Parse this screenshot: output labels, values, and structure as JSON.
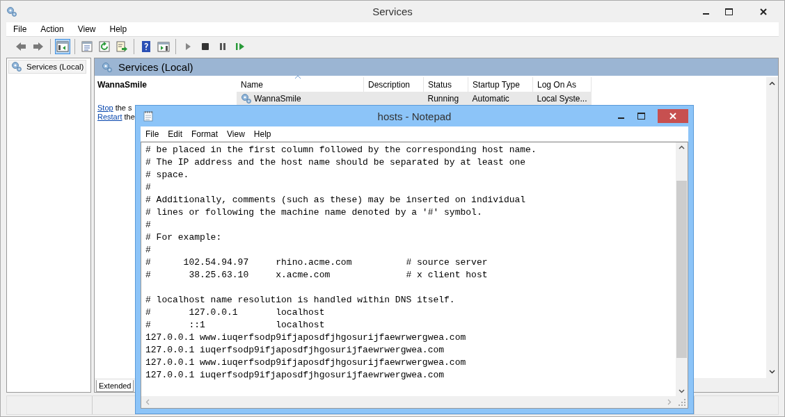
{
  "window": {
    "title": "Services"
  },
  "menu": [
    "File",
    "Action",
    "View",
    "Help"
  ],
  "toolbar": [
    [
      {
        "kind": "back",
        "selected": false
      },
      {
        "kind": "forward",
        "selected": false
      }
    ],
    [
      {
        "kind": "tree",
        "selected": true
      }
    ],
    [
      {
        "kind": "properties",
        "selected": false
      },
      {
        "kind": "refresh",
        "selected": false
      },
      {
        "kind": "export",
        "selected": false
      }
    ],
    [
      {
        "kind": "help",
        "selected": false
      },
      {
        "kind": "pane",
        "selected": false
      }
    ],
    [
      {
        "kind": "play",
        "selected": false
      },
      {
        "kind": "stop",
        "selected": false
      },
      {
        "kind": "pause",
        "selected": false
      },
      {
        "kind": "resume",
        "selected": false
      }
    ]
  ],
  "tree": {
    "items": [
      {
        "label": "Services (Local)",
        "selected": true
      }
    ]
  },
  "panel": {
    "title": "Services (Local)",
    "service_name": "WannaSmile",
    "actions": [
      {
        "link": "Stop",
        "text": " the s"
      },
      {
        "link": "Restart",
        "text": " the"
      }
    ]
  },
  "table": {
    "columns": [
      "Name",
      "Description",
      "Status",
      "Startup Type",
      "Log On As"
    ],
    "rows": [
      {
        "name": "WannaSmile",
        "description": "",
        "status": "Running",
        "startup_type": "Automatic",
        "log_on_as": "Local Syste...",
        "selected": true
      }
    ]
  },
  "tabs": [
    {
      "label": "Extended",
      "selected": true
    }
  ],
  "notepad": {
    "title": "hosts - Notepad",
    "menu": [
      "File",
      "Edit",
      "Format",
      "View",
      "Help"
    ],
    "content": "# be placed in the first column followed by the corresponding host name.\n# The IP address and the host name should be separated by at least one\n# space.\n#\n# Additionally, comments (such as these) may be inserted on individual\n# lines or following the machine name denoted by a '#' symbol.\n#\n# For example:\n#\n#      102.54.94.97     rhino.acme.com          # source server\n#       38.25.63.10     x.acme.com              # x client host\n\n# localhost name resolution is handled within DNS itself.\n#       127.0.0.1       localhost\n#       ::1             localhost\n127.0.0.1 www.iuqerfsodp9ifjaposdfjhgosurijfaewrwergwea.com\n127.0.0.1 iuqerfsodp9ifjaposdfjhgosurijfaewrwergwea.com\n127.0.0.1 www.iuqerfsodp9ifjaposdfjhgosurijfaewrwergwea.com\n127.0.0.1 iuqerfsodp9ifjaposdfjhgosurijfaewrwergwea.com"
  }
}
